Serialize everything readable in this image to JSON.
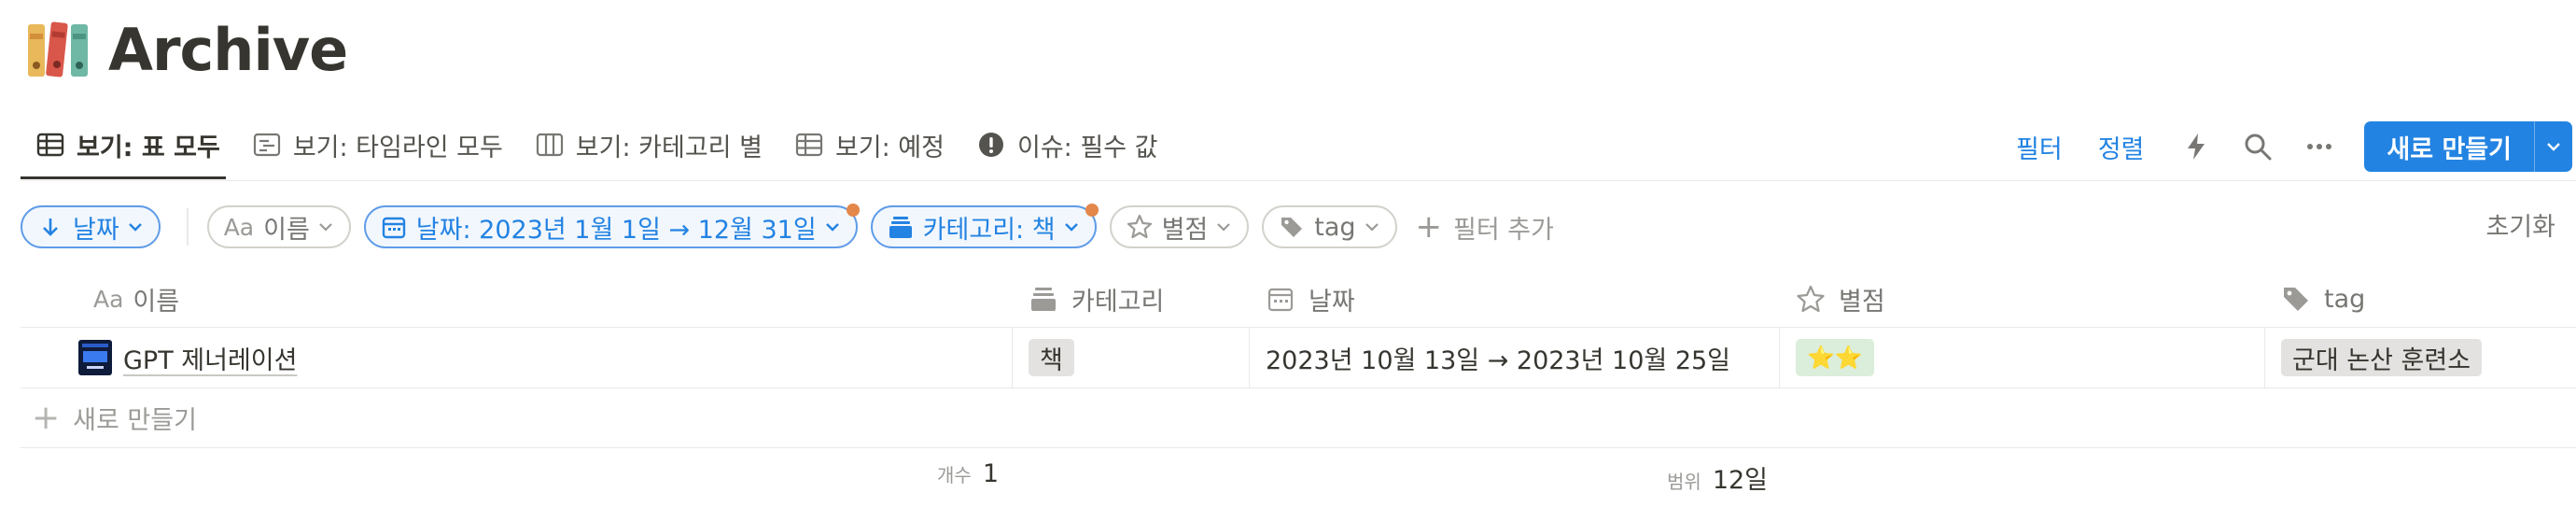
{
  "page": {
    "title": "Archive"
  },
  "views": [
    {
      "label": "보기: 표 모두",
      "icon": "table-icon",
      "active": true
    },
    {
      "label": "보기: 타임라인 모두",
      "icon": "timeline-icon"
    },
    {
      "label": "보기: 카테고리 별",
      "icon": "board-icon"
    },
    {
      "label": "보기: 예정",
      "icon": "table-icon"
    },
    {
      "label": "이슈: 필수 값",
      "icon": "alert-icon"
    }
  ],
  "toolbar": {
    "filter": "필터",
    "sort": "정렬",
    "new": "새로 만들기"
  },
  "filters": {
    "sort_chip": "날짜",
    "name_chip": "이름",
    "date_chip": "날짜: 2023년 1월 1일 → 12월 31일",
    "category_chip": "카테고리: 책",
    "rating_chip": "별점",
    "tag_chip": "tag",
    "add_filter": "필터 추가",
    "reset": "초기화"
  },
  "columns": [
    "이름",
    "카테고리",
    "날짜",
    "별점",
    "tag"
  ],
  "rows": [
    {
      "name": "GPT 제너레이션",
      "category": "책",
      "date": "2023년 10월 13일 → 2023년 10월 25일",
      "rating": "⭐⭐",
      "tag": "군대 논산 훈련소"
    }
  ],
  "new_row_label": "새로 만들기",
  "footer": {
    "count_label": "개수",
    "count_value": "1",
    "range_label": "범위",
    "range_value": "12일"
  },
  "colors": {
    "accent": "#2383e2",
    "text": "#37352f",
    "muted": "#787774",
    "dot": "#e3874a"
  }
}
